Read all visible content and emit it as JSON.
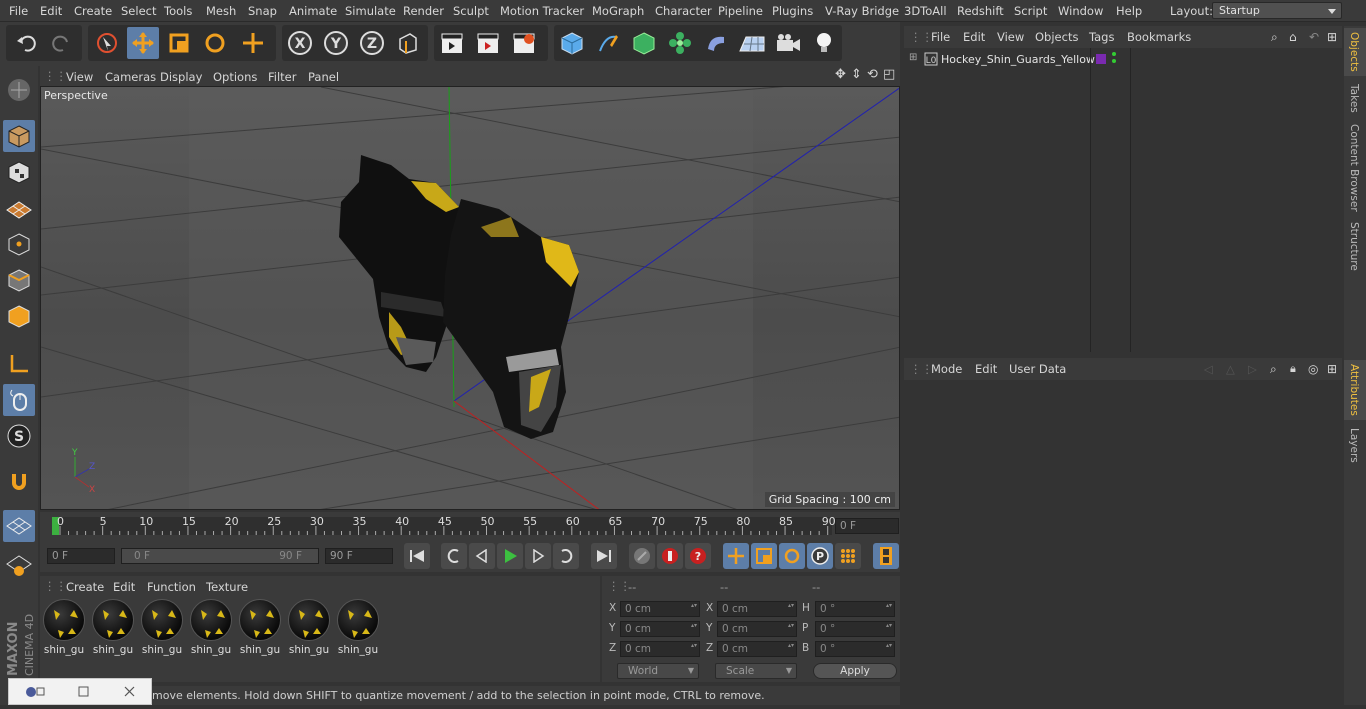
{
  "menubar": {
    "items": [
      "File",
      "Edit",
      "Create",
      "Select",
      "Tools",
      "Mesh",
      "Snap",
      "Animate",
      "Simulate",
      "Render",
      "Sculpt",
      "Motion Tracker",
      "MoGraph",
      "Character",
      "Pipeline",
      "Plugins",
      "V-Ray Bridge",
      "3DToAll",
      "Redshift",
      "Script",
      "Window",
      "Help"
    ],
    "layout_label": "Layout:",
    "layout_value": "Startup"
  },
  "toolbar": {
    "x_label": "X",
    "y_label": "Y",
    "z_label": "Z"
  },
  "viewport": {
    "menu": [
      "View",
      "Cameras",
      "Display",
      "Options",
      "Filter",
      "Panel"
    ],
    "camera_label": "Perspective",
    "grid_spacing": "Grid Spacing : 100 cm"
  },
  "timeline": {
    "ticks": [
      "0",
      "5",
      "10",
      "15",
      "20",
      "25",
      "30",
      "35",
      "40",
      "45",
      "50",
      "55",
      "60",
      "65",
      "70",
      "75",
      "80",
      "85",
      "90"
    ],
    "current_frame": "0 F"
  },
  "transport": {
    "start_field": "0 F",
    "range_start": "0 F",
    "range_end": "90 F",
    "end_field": "90 F"
  },
  "material_manager": {
    "menu": [
      "Create",
      "Edit",
      "Function",
      "Texture"
    ],
    "materials": [
      "shin_gu",
      "shin_gu",
      "shin_gu",
      "shin_gu",
      "shin_gu",
      "shin_gu",
      "shin_gu"
    ]
  },
  "coord_manager": {
    "headers": [
      "--",
      "--",
      "--"
    ],
    "rows": [
      {
        "a": "X",
        "av": "0 cm",
        "b": "X",
        "bv": "0 cm",
        "c": "H",
        "cv": "0 °"
      },
      {
        "a": "Y",
        "av": "0 cm",
        "b": "Y",
        "bv": "0 cm",
        "c": "P",
        "cv": "0 °"
      },
      {
        "a": "Z",
        "av": "0 cm",
        "b": "Z",
        "bv": "0 cm",
        "c": "B",
        "cv": "0 °"
      }
    ],
    "world": "World",
    "scale": "Scale",
    "apply": "Apply"
  },
  "object_manager": {
    "menu": [
      "File",
      "Edit",
      "View",
      "Objects",
      "Tags",
      "Bookmarks"
    ],
    "object_name": "Hockey_Shin_Guards_Yellow"
  },
  "attribute_manager": {
    "menu": [
      "Mode",
      "Edit",
      "User Data"
    ]
  },
  "right_tabs": [
    "Objects",
    "Takes",
    "Content Browser",
    "Structure",
    "Attributes",
    "Layers"
  ],
  "status": "move elements. Hold down SHIFT to quantize movement / add to the selection in point mode, CTRL to remove.",
  "branding": {
    "maxon": "MAXON",
    "cinema": "CINEMA 4D"
  },
  "colors": {
    "accent": "#5d7ea8",
    "brand_yellow": "#e8c020"
  }
}
